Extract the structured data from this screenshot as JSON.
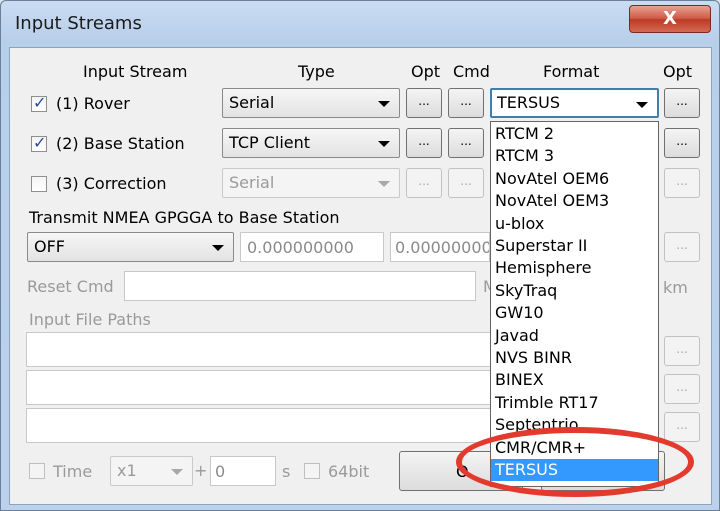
{
  "window": {
    "title": "Input Streams",
    "close_icon": "x-icon"
  },
  "headers": {
    "input_stream": "Input Stream",
    "type": "Type",
    "opt": "Opt",
    "cmd": "Cmd",
    "format": "Format",
    "opt2": "Opt"
  },
  "streams": [
    {
      "label": "(1) Rover",
      "checked": true,
      "type": "Serial",
      "format": "TERSUS",
      "opt_btn": "...",
      "cmd_btn": "...",
      "fmt_opt_btn": "..."
    },
    {
      "label": "(2) Base Station",
      "checked": true,
      "type": "TCP Client",
      "opt_btn": "...",
      "cmd_btn": "...",
      "fmt_opt_btn": "..."
    },
    {
      "label": "(3) Correction",
      "checked": false,
      "type": "Serial",
      "opt_btn": "...",
      "cmd_btn": "...",
      "fmt_opt_btn": "..."
    }
  ],
  "nmea": {
    "label": "Transmit NMEA GPGGA to Base Station",
    "mode": "OFF",
    "lat": "0.000000000",
    "lon": "0.00000000",
    "btn": "..."
  },
  "reset": {
    "label": "Reset Cmd",
    "partial_label": "M",
    "unit": "km"
  },
  "paths": {
    "label": "Input File Paths",
    "btn": "..."
  },
  "bottom": {
    "time_label": "Time",
    "speed": "x1",
    "plus": "+",
    "offset": "0",
    "unit": "s",
    "bit_label": "64bit",
    "ok_partial": "O"
  },
  "format_options": [
    "RTCM 2",
    "RTCM 3",
    "NovAtel OEM6",
    "NovAtel OEM3",
    "u-blox",
    "Superstar II",
    "Hemisphere",
    "SkyTraq",
    "GW10",
    "Javad",
    "NVS BINR",
    "BINEX",
    "Trimble RT17",
    "Septentrio",
    "CMR/CMR+",
    "TERSUS"
  ],
  "selected_format": "TERSUS",
  "annotation_color": "#e33a2e"
}
